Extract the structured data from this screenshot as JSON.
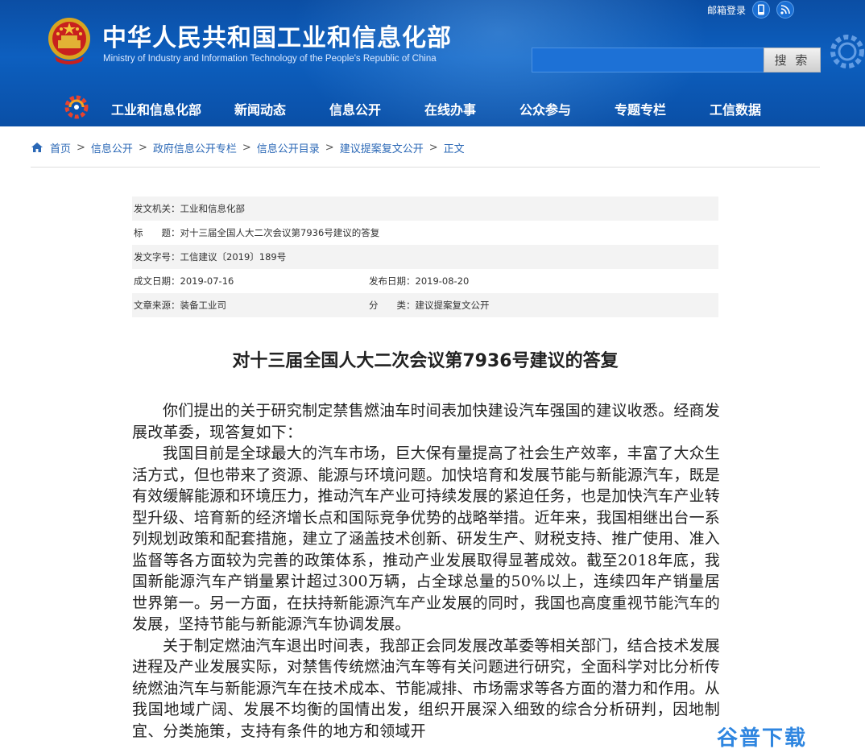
{
  "header": {
    "title": "中华人民共和国工业和信息化部",
    "subtitle": "Ministry of Industry and Information Technology of the People's Republic of China",
    "mail_login": "邮箱登录",
    "search_placeholder": "",
    "search_button": "搜 索",
    "brand_color": "#0d5fbf"
  },
  "nav": {
    "items": [
      "工业和信息化部",
      "新闻动态",
      "信息公开",
      "在线办事",
      "公众参与",
      "专题专栏",
      "工信数据"
    ]
  },
  "breadcrumb": {
    "items": [
      "首页",
      "信息公开",
      "政府信息公开专栏",
      "信息公开目录",
      "建议提案复文公开",
      "正文"
    ],
    "separator": ">"
  },
  "meta": {
    "issuer": "发文机关：工业和信息化部",
    "title": "标　　题：对十三届全国人大二次会议第7936号建议的答复",
    "doc_number": "发文字号：工信建议〔2019〕189号",
    "date_created": "成文日期：2019-07-16",
    "date_published": "发布日期：2019-08-20",
    "source": "文章来源：装备工业司",
    "category": "分　　类：建议提案复文公开"
  },
  "article": {
    "title": "对十三届全国人大二次会议第7936号建议的答复",
    "paragraphs": [
      "你们提出的关于研究制定禁售燃油车时间表加快建设汽车强国的建议收悉。经商发展改革委，现答复如下：",
      "我国目前是全球最大的汽车市场，巨大保有量提高了社会生产效率，丰富了大众生活方式，但也带来了资源、能源与环境问题。加快培育和发展节能与新能源汽车，既是有效缓解能源和环境压力，推动汽车产业可持续发展的紧迫任务，也是加快汽车产业转型升级、培育新的经济增长点和国际竞争优势的战略举措。近年来，我国相继出台一系列规划政策和配套措施，建立了涵盖技术创新、研发生产、财税支持、推广使用、准入监督等各方面较为完善的政策体系，推动产业发展取得显著成效。截至2018年底，我国新能源汽车产销量累计超过300万辆，占全球总量的50%以上，连续四年产销量居世界第一。另一方面，在扶持新能源汽车产业发展的同时，我国也高度重视节能汽车的发展，坚持节能与新能源汽车协调发展。",
      "关于制定燃油汽车退出时间表，我部正会同发展改革委等相关部门，结合技术发展进程及产业发展实际，对禁售传统燃油汽车等有关问题进行研究，全面科学对比分析传统燃油汽车与新能源汽车在技术成本、节能减排、市场需求等各方面的潜力和作用。从我国地域广阔、发展不均衡的国情出发，组织开展深入细致的综合分析研判，因地制宜、分类施策，支持有条件的地方和领域开"
    ]
  },
  "watermark": "谷普下载",
  "icons": {
    "emblem": "national-emblem-icon",
    "mobile": "mobile-icon",
    "rss": "rss-icon",
    "home": "home-icon",
    "gear": "gear-decoration-icon",
    "nav_logo": "ministry-logo-icon"
  }
}
